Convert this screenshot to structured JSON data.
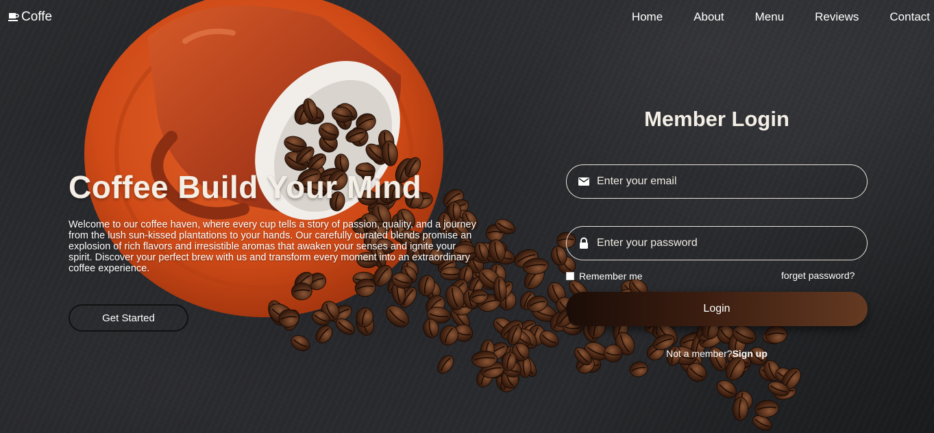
{
  "brand": {
    "name": "Coffe",
    "icon": "coffee-cup-icon"
  },
  "nav": {
    "items": [
      "Home",
      "About",
      "Menu",
      "Reviews",
      "Contact"
    ]
  },
  "hero": {
    "title": "Coffee Build Your Mind",
    "description": "Welcome to our coffee haven, where every cup tells a story of passion, quality, and a journey from the lush sun-kissed plantations to your hands. Our carefully curated blends promise an explosion of rich flavors and irresistible aromas that awaken your senses and ignite your spirit. Discover your perfect brew with us and transform every moment into an extraordinary coffee experience.",
    "cta_label": "Get Started"
  },
  "login": {
    "title": "Member Login",
    "email_placeholder": "Enter your email",
    "email_icon": "envelope-icon",
    "password_placeholder": "Enter your password",
    "password_icon": "lock-icon",
    "remember_label": "Remember me",
    "forgot_label": "forget password?",
    "submit_label": "Login",
    "signup_prompt": "Not a member?",
    "signup_link": "Sign up"
  },
  "colors": {
    "saucer": "#d9501c",
    "cup": "#b8431c",
    "login_button_start": "#1a0c07",
    "login_button_end": "#643a22"
  }
}
